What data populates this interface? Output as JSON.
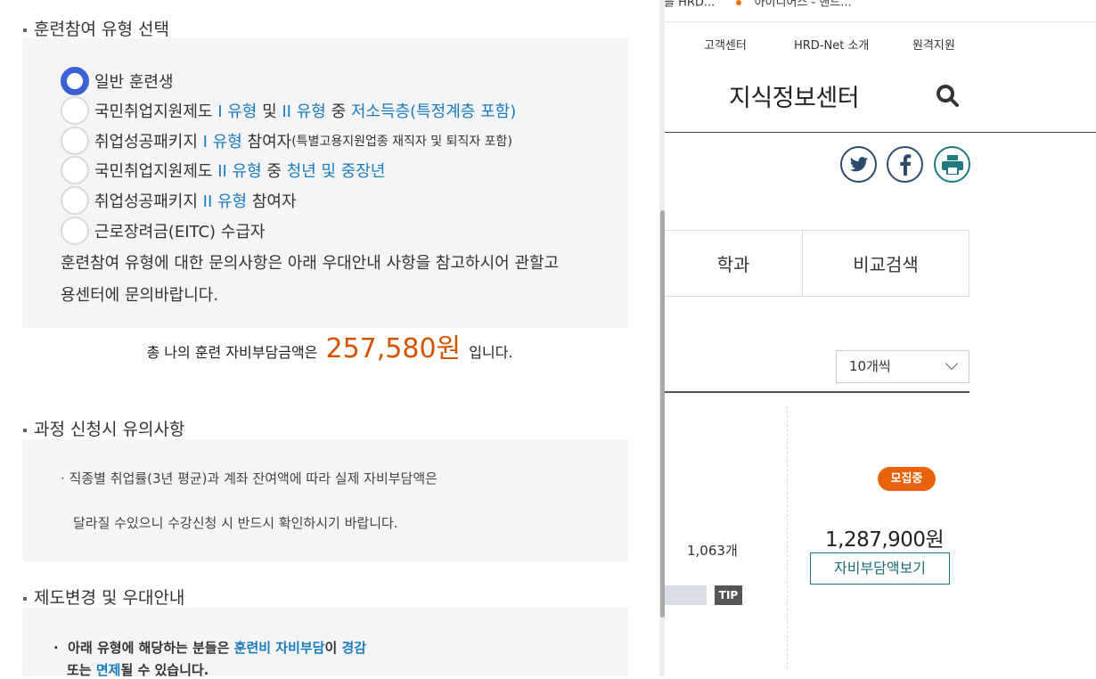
{
  "background_page": {
    "bookmarks": [
      "를 HRD...",
      "아이디어스 - 핸드..."
    ],
    "util_links": [
      "고객센터",
      "HRD-Net 소개",
      "원격지원"
    ],
    "site_title": "지식정보센터",
    "tabs": [
      "학과",
      "비교검색"
    ],
    "per_page_select": "10개씩",
    "badge": "모집중",
    "price": "1,287,900원",
    "burden_button": "자비부담액보기",
    "count": "1,063개",
    "tip": "TIP",
    "colors": {
      "accent": "#1e7a80",
      "badge": "#e8630a",
      "sns": "#2d4b6e"
    }
  },
  "panel": {
    "section1": {
      "title": "훈련참여 유형 선택",
      "options": [
        {
          "selected": true,
          "parts": [
            {
              "t": "일반 훈련생",
              "c": ""
            }
          ]
        },
        {
          "selected": false,
          "parts": [
            {
              "t": "국민취업지원제도 ",
              "c": ""
            },
            {
              "t": "I 유형",
              "c": "blue"
            },
            {
              "t": " 및 ",
              "c": ""
            },
            {
              "t": "II 유형",
              "c": "blue"
            },
            {
              "t": " 중 ",
              "c": ""
            },
            {
              "t": "저소득층(특정계층 포함)",
              "c": "blue"
            }
          ]
        },
        {
          "selected": false,
          "parts": [
            {
              "t": "취업성공패키지 ",
              "c": ""
            },
            {
              "t": "I 유형",
              "c": "blue"
            },
            {
              "t": " 참여자",
              "c": ""
            },
            {
              "t": "(특별고용지원업종 재직자 및 퇴직자 포함)",
              "c": "small"
            }
          ]
        },
        {
          "selected": false,
          "parts": [
            {
              "t": "국민취업지원제도 ",
              "c": ""
            },
            {
              "t": "II 유형",
              "c": "blue"
            },
            {
              "t": " 중 ",
              "c": ""
            },
            {
              "t": "청년 및 중장년",
              "c": "blue"
            }
          ]
        },
        {
          "selected": false,
          "parts": [
            {
              "t": "취업성공패키지 ",
              "c": ""
            },
            {
              "t": "II 유형",
              "c": "blue"
            },
            {
              "t": " 참여자",
              "c": ""
            }
          ]
        },
        {
          "selected": false,
          "parts": [
            {
              "t": "근로장려금(EITC) 수급자",
              "c": ""
            }
          ]
        }
      ],
      "note_line1": "훈련참여 유형에 대한 문의사항은 아래 우대안내 사항을 참고하시어 관할고",
      "note_line2": "용센터에 문의바랍니다."
    },
    "total": {
      "prefix": "총 나의 훈련 자비부담금액은",
      "amount": "257,580원",
      "suffix": "입니다."
    },
    "section2": {
      "title": "과정 신청시 유의사항",
      "line1": "·  직종별 취업률(3년 평균)과 계좌 잔여액에 따라 실제 자비부담액은",
      "line2": "달라질 수있으니 수강신청 시 반드시 확인하시기 바랍니다."
    },
    "section3": {
      "title": "제도변경 및 우대안내",
      "line1_parts": [
        {
          "t": "·  아래 유형에 해당하는 분들은 ",
          "c": ""
        },
        {
          "t": "훈련비 자비부담",
          "c": "blue"
        },
        {
          "t": "이 ",
          "c": ""
        },
        {
          "t": "경감",
          "c": "blue"
        }
      ],
      "line2_parts": [
        {
          "t": "또는 ",
          "c": ""
        },
        {
          "t": "면제",
          "c": "blue"
        },
        {
          "t": "될 수 있습니다.",
          "c": ""
        }
      ]
    },
    "colors": {
      "radio_on": "#3a62d6",
      "highlight": "#1a7bbf",
      "amount": "#d35400"
    }
  }
}
